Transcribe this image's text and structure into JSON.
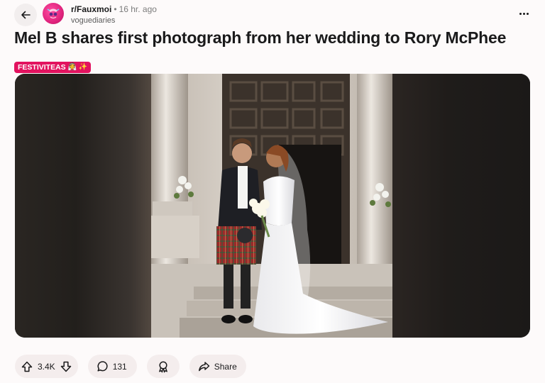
{
  "header": {
    "subreddit": "r/Fauxmoi",
    "separator": "•",
    "time_ago": "16 hr. ago",
    "username": "voguediaries"
  },
  "post": {
    "title": "Mel B shares first photograph from her wedding to Rory McPhee",
    "flair_text": "FESTIVITEAS",
    "flair_emoji": "👰 ✨",
    "flair_color": "#e2135f"
  },
  "icons": {
    "back": "arrow-left-icon",
    "more": "more-horizontal-icon",
    "upvote": "upvote-arrow-icon",
    "downvote": "downvote-arrow-icon",
    "comment": "comment-bubble-icon",
    "award": "award-ribbon-icon",
    "share": "share-arrow-icon"
  },
  "actions": {
    "vote_count": "3.4K",
    "comment_count": "131",
    "share_label": "Share"
  }
}
